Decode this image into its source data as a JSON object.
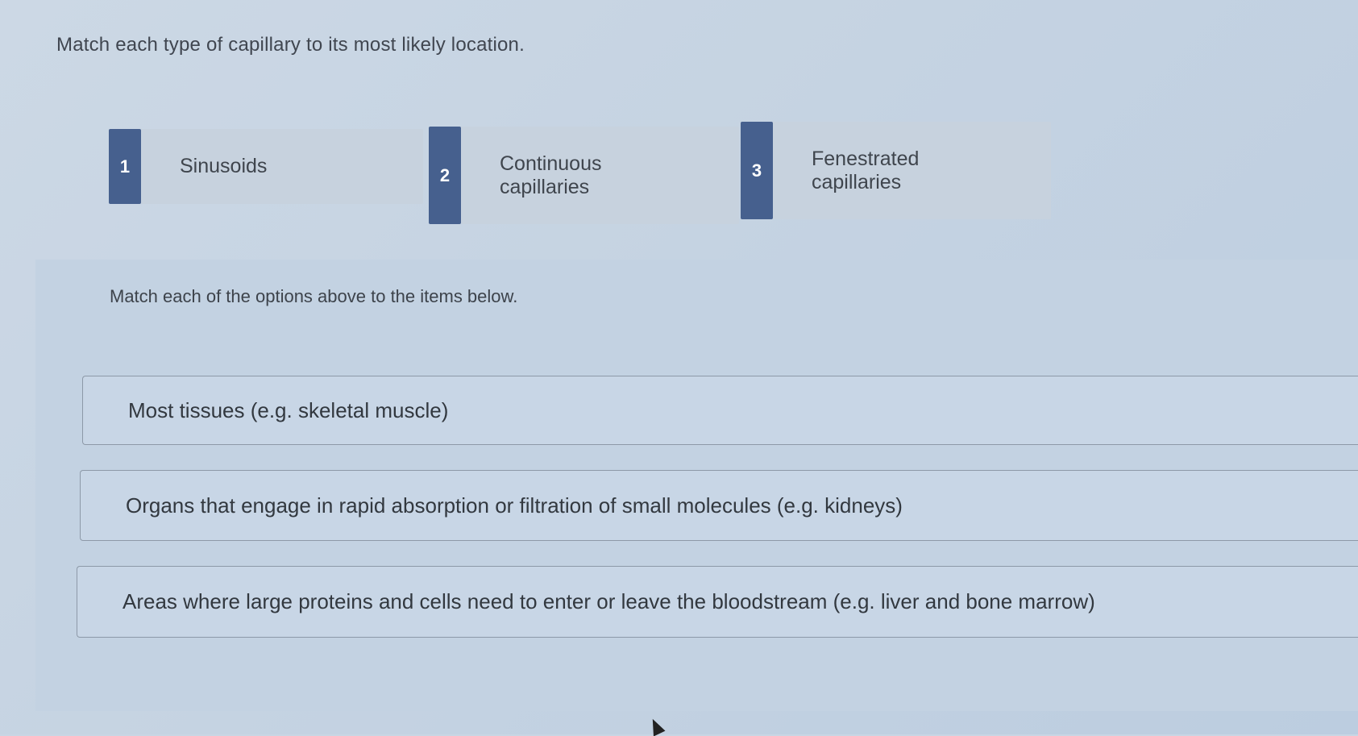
{
  "question": {
    "prompt": "Match each type of capillary to its most likely location."
  },
  "options": [
    {
      "number": "1",
      "label": "Sinusoids"
    },
    {
      "number": "2",
      "label": "Continuous\ncapillaries"
    },
    {
      "number": "3",
      "label": "Fenestrated\ncapillaries"
    }
  ],
  "match_area": {
    "instruction": "Match each of the options above to the items below.",
    "targets": [
      {
        "text": "Most tissues (e.g. skeletal muscle)"
      },
      {
        "text": "Organs that engage in rapid absorption or filtration of small molecules (e.g. kidneys)"
      },
      {
        "text": "Areas where large proteins and cells need to enter or leave the bloodstream (e.g. liver and bone marrow)"
      }
    ]
  },
  "colors": {
    "number_badge": "#46608e",
    "background": "#c9d6e4"
  }
}
